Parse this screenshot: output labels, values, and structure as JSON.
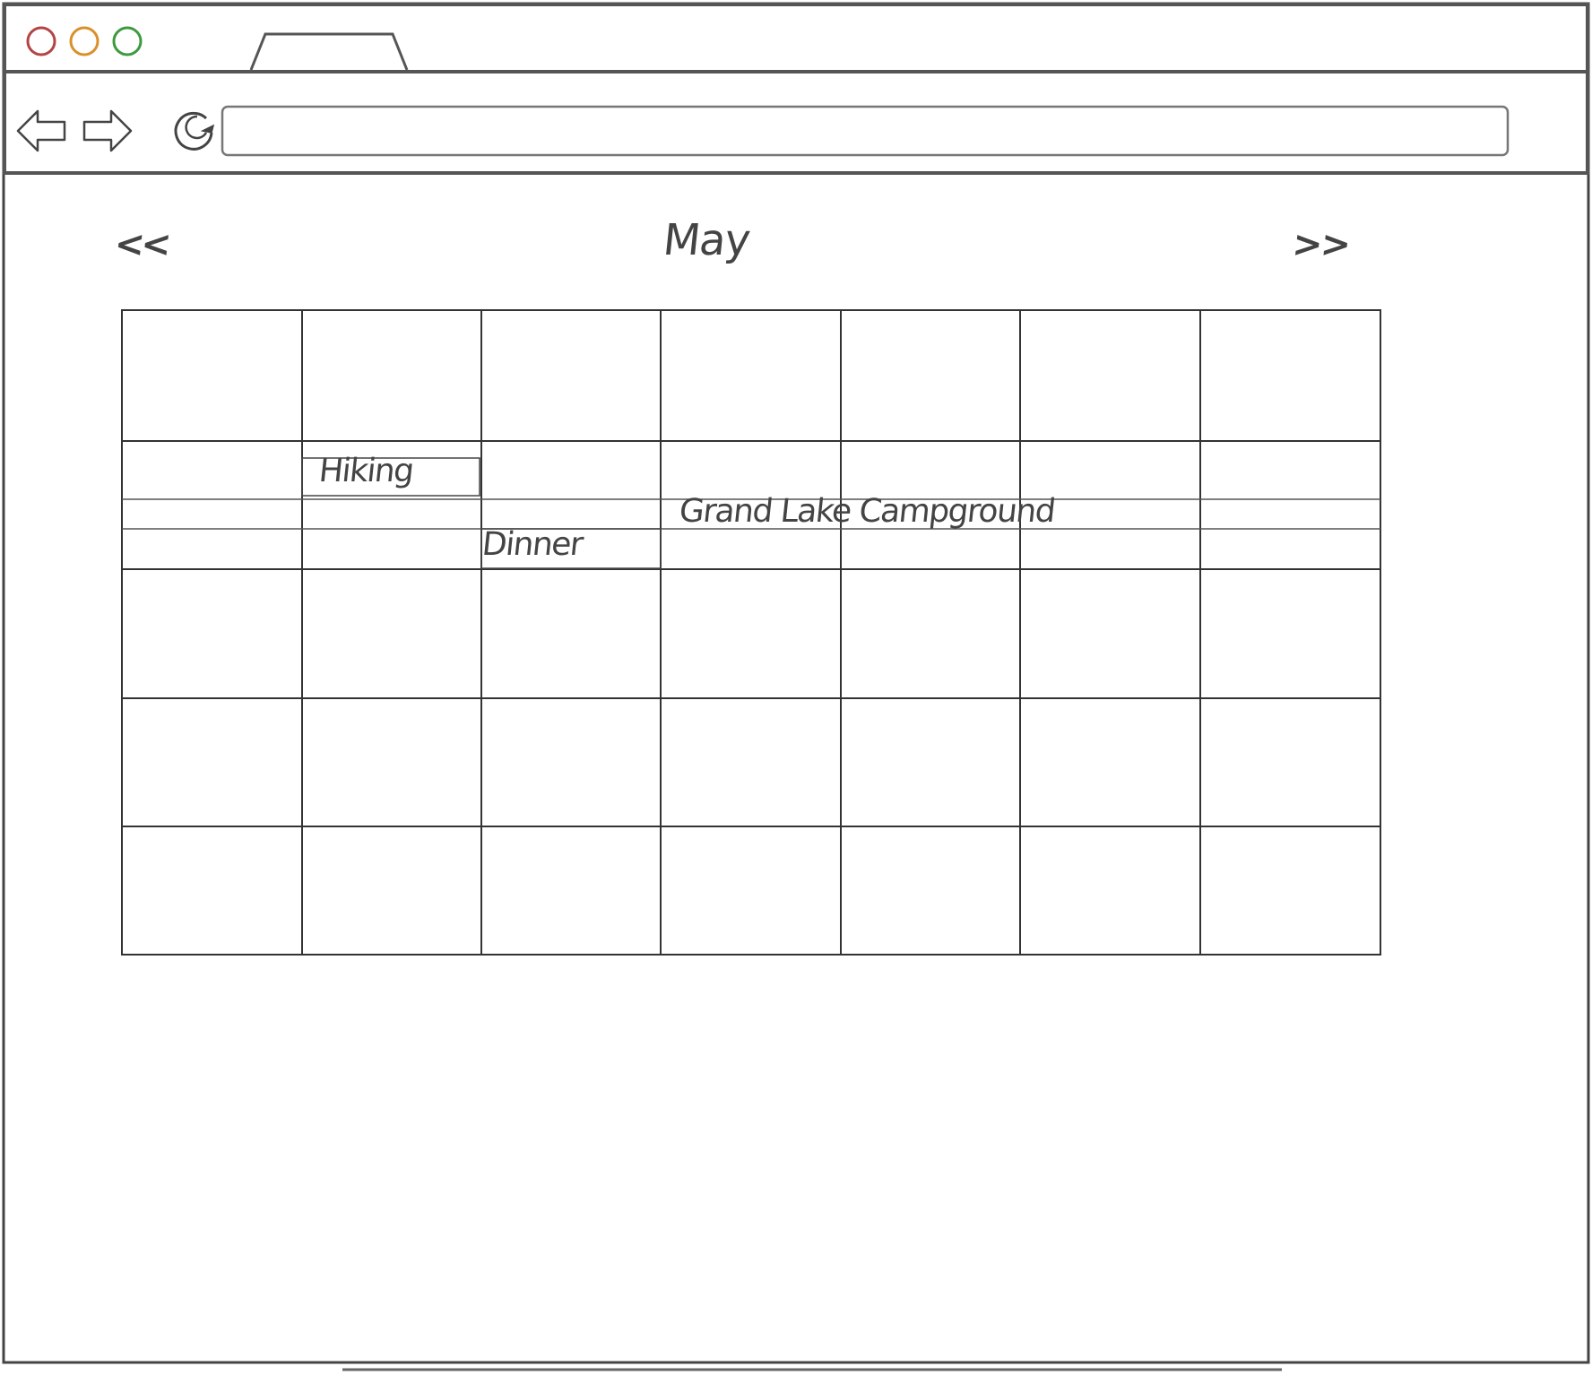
{
  "browser": {
    "window_controls": [
      "close",
      "minimize",
      "maximize"
    ],
    "colors": {
      "close": "#b44444",
      "minimize": "#d9902b",
      "maximize": "#3e9a3e",
      "ink": "#444444"
    },
    "nav_icons": [
      "back-arrow-icon",
      "forward-arrow-icon",
      "reload-icon"
    ],
    "address_bar": {
      "value": "",
      "placeholder": ""
    }
  },
  "calendar": {
    "month": "May",
    "prev_label": "<<",
    "next_label": ">>",
    "columns": 7,
    "week_rows": 5,
    "events": [
      {
        "label": "Hiking",
        "week": 2,
        "day_start": 2,
        "day_span": 1
      },
      {
        "label": "Grand Lake Campground",
        "week": 2,
        "day_start": 1,
        "day_span": 7
      },
      {
        "label": "Dinner",
        "week": 2,
        "day_start": 3,
        "day_span": 1
      }
    ]
  }
}
